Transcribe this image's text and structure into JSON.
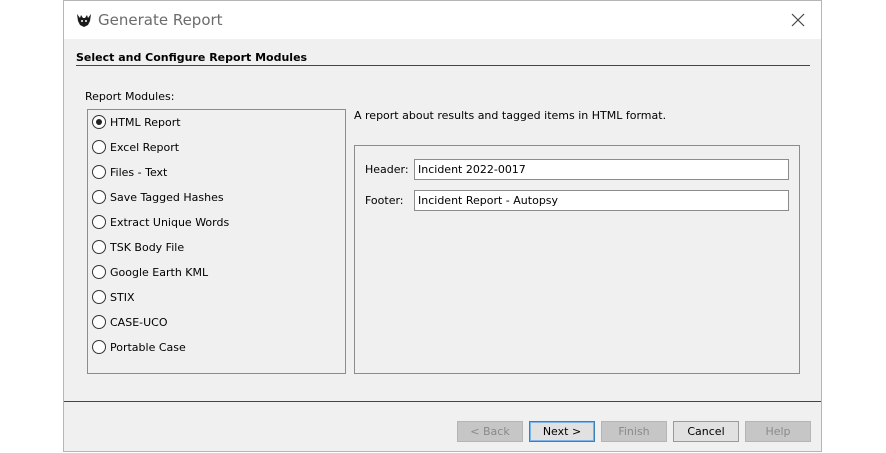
{
  "window": {
    "title": "Generate Report",
    "app_icon": "autopsy-dog-icon",
    "close_icon": "close-icon"
  },
  "section": {
    "heading": "Select and Configure Report Modules"
  },
  "modules": {
    "label": "Report Modules:",
    "selected": "HTML Report",
    "items": [
      {
        "label": "HTML Report",
        "selected": true
      },
      {
        "label": "Excel Report",
        "selected": false
      },
      {
        "label": "Files - Text",
        "selected": false
      },
      {
        "label": "Save Tagged Hashes",
        "selected": false
      },
      {
        "label": "Extract Unique Words",
        "selected": false
      },
      {
        "label": "TSK Body File",
        "selected": false
      },
      {
        "label": "Google Earth KML",
        "selected": false
      },
      {
        "label": "STIX",
        "selected": false
      },
      {
        "label": "CASE-UCO",
        "selected": false
      },
      {
        "label": "Portable Case",
        "selected": false
      }
    ]
  },
  "description": "A report about results and tagged items in HTML format.",
  "config": {
    "header_label": "Header:",
    "header_value": "Incident 2022-0017",
    "footer_label": "Footer:",
    "footer_value": "Incident Report - Autopsy"
  },
  "buttons": {
    "back": {
      "label": "< Back",
      "enabled": false
    },
    "next": {
      "label": "Next >",
      "enabled": true
    },
    "finish": {
      "label": "Finish",
      "enabled": false
    },
    "cancel": {
      "label": "Cancel",
      "enabled": true
    },
    "help": {
      "label": "Help",
      "enabled": false
    }
  }
}
